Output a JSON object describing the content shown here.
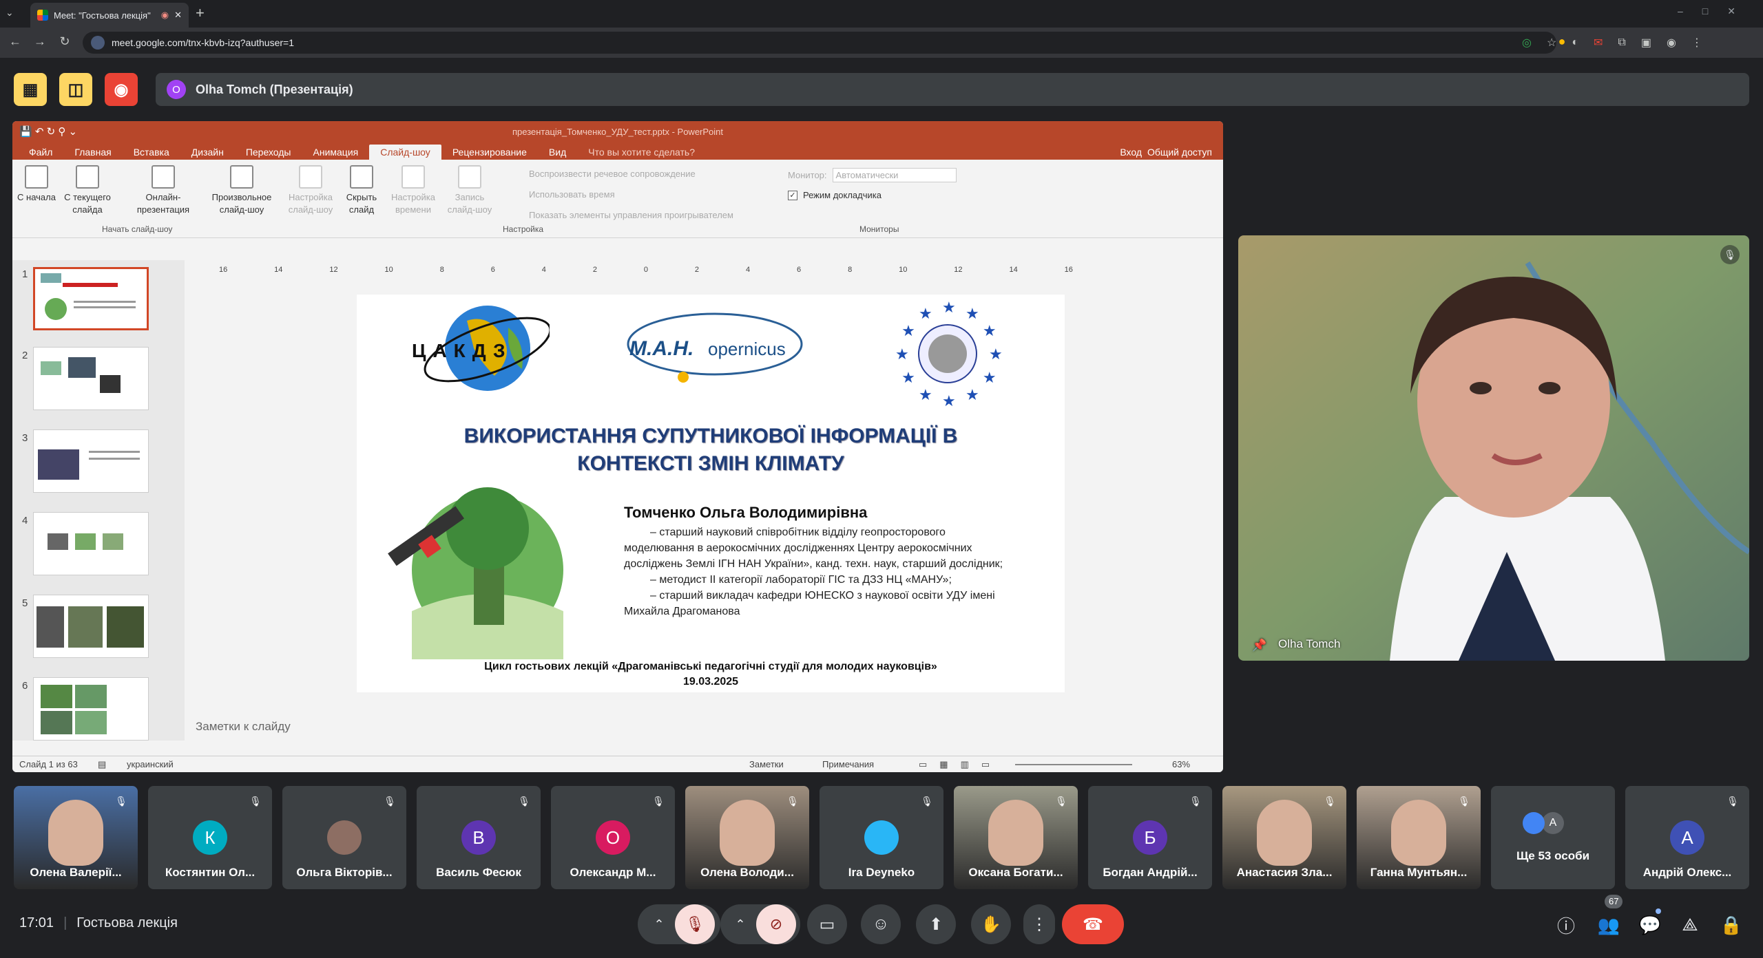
{
  "browser": {
    "tab_title": "Meet: \"Гостьова лекція\"",
    "url": "meet.google.com/tnx-kbvb-izq?authuser=1"
  },
  "presenter_banner": {
    "avatar_letter": "O",
    "name": "Olha Tomch (Презентація)"
  },
  "powerpoint": {
    "title": "презентація_Томченко_УДУ_тест.pptx - PowerPoint",
    "tabs": [
      "Файл",
      "Главная",
      "Вставка",
      "Дизайн",
      "Переходы",
      "Анимация",
      "Слайд-шоу",
      "Рецензирование",
      "Вид"
    ],
    "active_tab": "Слайд-шоу",
    "tell_me": "Что вы хотите сделать?",
    "signin": "Вход",
    "share": "Общий доступ",
    "ribbon": {
      "from_start": "С начала",
      "from_current": "С текущего слайда",
      "online": "Онлайн-презентация",
      "custom": "Произвольное слайд-шоу",
      "setup": "Настройка слайд-шоу",
      "hide": "Скрыть слайд",
      "rehearse": "Настройка времени",
      "record": "Запись слайд-шоу",
      "group_start": "Начать слайд-шоу",
      "opt_narration": "Воспроизвести речевое сопровождение",
      "opt_timings": "Использовать время",
      "opt_controls": "Показать элементы управления проигрывателем",
      "group_setup": "Настройка",
      "monitor_label": "Монитор:",
      "monitor_value": "Автоматически",
      "presenter_view": "Режим докладчика",
      "group_monitors": "Мониторы"
    },
    "thumb_numbers": [
      "1",
      "2",
      "3",
      "4",
      "5",
      "6"
    ],
    "slide": {
      "logo1": "ЦАКДЗ",
      "logo2a": "М.А.Н.",
      "logo2b": "opernicus",
      "title_line1": "ВИКОРИСТАННЯ СУПУТНИКОВОЇ ІНФОРМАЦІЇ В",
      "title_line2": "КОНТЕКСТІ ЗМІН КЛІМАТУ",
      "author": "Томченко Ольга Володимирівна",
      "bio": [
        "– старший науковий співробітник  відділу геопросторового",
        "моделювання в аерокосмічних дослідженнях Центру аерокосмічних",
        "досліджень Землі ІГН НАН України», канд. техн. наук, старший дослідник;",
        "– методист ІІ категорії лабораторії ГІС та ДЗЗ НЦ «МАНУ»;",
        "– старший викладач кафедри ЮНЕСКО з наукової освіти УДУ імені",
        "Михайла Драгоманова"
      ],
      "footer1": "Цикл гостьових лекцій «Драгоманівські педагогічні студії для молодих науковців»",
      "footer2": "19.03.2025"
    },
    "notes_placeholder": "Заметки к слайду",
    "status": {
      "slide_counter": "Слайд 1 из 63",
      "language": "украинский",
      "notes": "Заметки",
      "comments": "Примечания",
      "zoom": "63%"
    },
    "ruler": [
      "16",
      "14",
      "12",
      "10",
      "8",
      "6",
      "4",
      "2",
      "0",
      "2",
      "4",
      "6",
      "8",
      "10",
      "12",
      "14",
      "16"
    ]
  },
  "video": {
    "name": "Olha Tomch"
  },
  "participants": [
    {
      "name": "Олена Валерії...",
      "type": "photo",
      "color": "#4a6fa5"
    },
    {
      "name": "Костянтин Ол...",
      "type": "letter",
      "letter": "К",
      "color": "#00acc1"
    },
    {
      "name": "Ольга Вікторів...",
      "type": "smallphoto",
      "color": "#8d6e63"
    },
    {
      "name": "Василь Фесюк",
      "type": "letter",
      "letter": "В",
      "color": "#5e35b1"
    },
    {
      "name": "Олександр М...",
      "type": "letter",
      "letter": "О",
      "color": "#d81b60"
    },
    {
      "name": "Олена Володи...",
      "type": "photo",
      "color": "#9e8e7e"
    },
    {
      "name": "Ira Deyneko",
      "type": "smallphoto",
      "color": "#29b6f6"
    },
    {
      "name": "Оксана Богати...",
      "type": "photo",
      "color": "#9a9a8a"
    },
    {
      "name": "Богдан Андрій...",
      "type": "letter",
      "letter": "Б",
      "color": "#5e35b1"
    },
    {
      "name": "Анастасия Зла...",
      "type": "photo",
      "color": "#a89880"
    },
    {
      "name": "Ганна Мунтьян...",
      "type": "photo",
      "color": "#b0a090"
    },
    {
      "name": "Ще 53 особи",
      "type": "more",
      "letter": "A",
      "color": "#5f6368"
    },
    {
      "name": "Андрій Олекс...",
      "type": "letter",
      "letter": "А",
      "color": "#3f51b5"
    }
  ],
  "meeting": {
    "time": "17:01",
    "name": "Гостьова лекція"
  },
  "people_count": "67",
  "colors": {
    "end_call": "#ea4335",
    "mic_off": "#f9dedc",
    "accent": "#8ab4f8"
  }
}
